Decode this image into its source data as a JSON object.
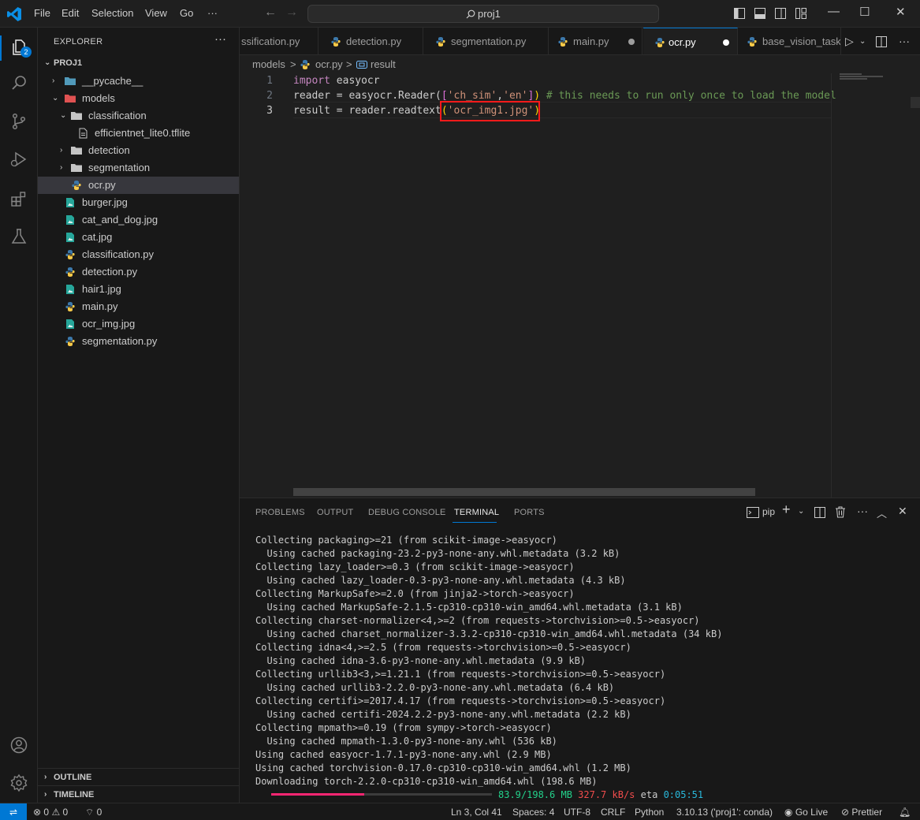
{
  "titlebar": {
    "menu": [
      "File",
      "Edit",
      "Selection",
      "View",
      "Go",
      "···"
    ],
    "search_text": "proj1"
  },
  "activity": {
    "explorer_badge": "2"
  },
  "sidebar": {
    "title": "EXPLORER",
    "project": "PROJ1",
    "items": [
      {
        "label": "__pycache__",
        "icon": "folder-icon",
        "expanded": false
      },
      {
        "label": "models",
        "icon": "folder-icon",
        "expanded": true
      },
      {
        "label": "classification",
        "icon": "folder-icon",
        "expanded": true
      },
      {
        "label": "efficientnet_lite0.tflite",
        "icon": "file-icon"
      },
      {
        "label": "detection",
        "icon": "folder-icon",
        "expanded": false
      },
      {
        "label": "segmentation",
        "icon": "folder-icon",
        "expanded": false
      },
      {
        "label": "ocr.py",
        "icon": "python-icon",
        "selected": true
      },
      {
        "label": "burger.jpg",
        "icon": "image-icon"
      },
      {
        "label": "cat_and_dog.jpg",
        "icon": "image-icon"
      },
      {
        "label": "cat.jpg",
        "icon": "image-icon"
      },
      {
        "label": "classification.py",
        "icon": "python-icon"
      },
      {
        "label": "detection.py",
        "icon": "python-icon"
      },
      {
        "label": "hair1.jpg",
        "icon": "image-icon"
      },
      {
        "label": "main.py",
        "icon": "python-icon"
      },
      {
        "label": "ocr_img.jpg",
        "icon": "image-icon"
      },
      {
        "label": "segmentation.py",
        "icon": "python-icon"
      }
    ],
    "outline": "OUTLINE",
    "timeline": "TIMELINE"
  },
  "tabs": [
    {
      "label": "ssification.py"
    },
    {
      "label": "detection.py"
    },
    {
      "label": "segmentation.py"
    },
    {
      "label": "main.py",
      "dirty": true
    },
    {
      "label": "ocr.py",
      "dirty": true,
      "active": true
    },
    {
      "label": "base_vision_task_"
    }
  ],
  "breadcrumb": [
    "models",
    ">",
    "ocr.py",
    ">",
    "result"
  ],
  "editor": {
    "line_numbers": [
      "1",
      "2",
      "3"
    ],
    "lines": [
      {
        "kw": "import",
        "rest": " easyocr"
      },
      {
        "a": "reader = easyocr.Reader(",
        "b1": "[",
        "s1": "'ch_sim'",
        "c": ",",
        "s2": "'en'",
        "b2": "]",
        "d": ")",
        "comment": " # this needs to run only once to load the model"
      },
      {
        "a": "result = reader.readtext",
        "p1": "(",
        "s": "'ocr_img1.jpg'",
        "p2": ")"
      }
    ]
  },
  "panel": {
    "tabs": [
      "PROBLEMS",
      "OUTPUT",
      "DEBUG CONSOLE",
      "TERMINAL",
      "PORTS"
    ],
    "active_tab": "TERMINAL",
    "shell": "pip",
    "terminal_lines": [
      "Collecting packaging>=21 (from scikit-image->easyocr)",
      "  Using cached packaging-23.2-py3-none-any.whl.metadata (3.2 kB)",
      "Collecting lazy_loader>=0.3 (from scikit-image->easyocr)",
      "  Using cached lazy_loader-0.3-py3-none-any.whl.metadata (4.3 kB)",
      "Collecting MarkupSafe>=2.0 (from jinja2->torch->easyocr)",
      "  Using cached MarkupSafe-2.1.5-cp310-cp310-win_amd64.whl.metadata (3.1 kB)",
      "Collecting charset-normalizer<4,>=2 (from requests->torchvision>=0.5->easyocr)",
      "  Using cached charset_normalizer-3.3.2-cp310-cp310-win_amd64.whl.metadata (34 kB)",
      "Collecting idna<4,>=2.5 (from requests->torchvision>=0.5->easyocr)",
      "  Using cached idna-3.6-py3-none-any.whl.metadata (9.9 kB)",
      "Collecting urllib3<3,>=1.21.1 (from requests->torchvision>=0.5->easyocr)",
      "  Using cached urllib3-2.2.0-py3-none-any.whl.metadata (6.4 kB)",
      "Collecting certifi>=2017.4.17 (from requests->torchvision>=0.5->easyocr)",
      "  Using cached certifi-2024.2.2-py3-none-any.whl.metadata (2.2 kB)",
      "Collecting mpmath>=0.19 (from sympy->torch->easyocr)",
      "  Using cached mpmath-1.3.0-py3-none-any.whl (536 kB)",
      "Using cached easyocr-1.7.1-py3-none-any.whl (2.9 MB)",
      "Using cached torchvision-0.17.0-cp310-cp310-win_amd64.whl (1.2 MB)",
      "Downloading torch-2.2.0-cp310-cp310-win_amd64.whl (198.6 MB)"
    ],
    "progress": {
      "fraction": 0.4225,
      "size": "83.9/198.6 MB",
      "speed": "327.7 kB/s",
      "eta_label": "eta",
      "eta": "0:05:51"
    }
  },
  "statusbar": {
    "errors": "0",
    "warnings": "0",
    "ports": "0",
    "position": "Ln 3, Col 41",
    "spaces": "Spaces: 4",
    "encoding": "UTF-8",
    "eol": "CRLF",
    "language": "Python",
    "interpreter": "3.10.13 ('proj1': conda)",
    "golive": "Go Live",
    "prettier": "Prettier"
  },
  "colors": {
    "accent": "#0078d4",
    "highlight_box": "#ff1a1a",
    "progress": "#f92672"
  }
}
